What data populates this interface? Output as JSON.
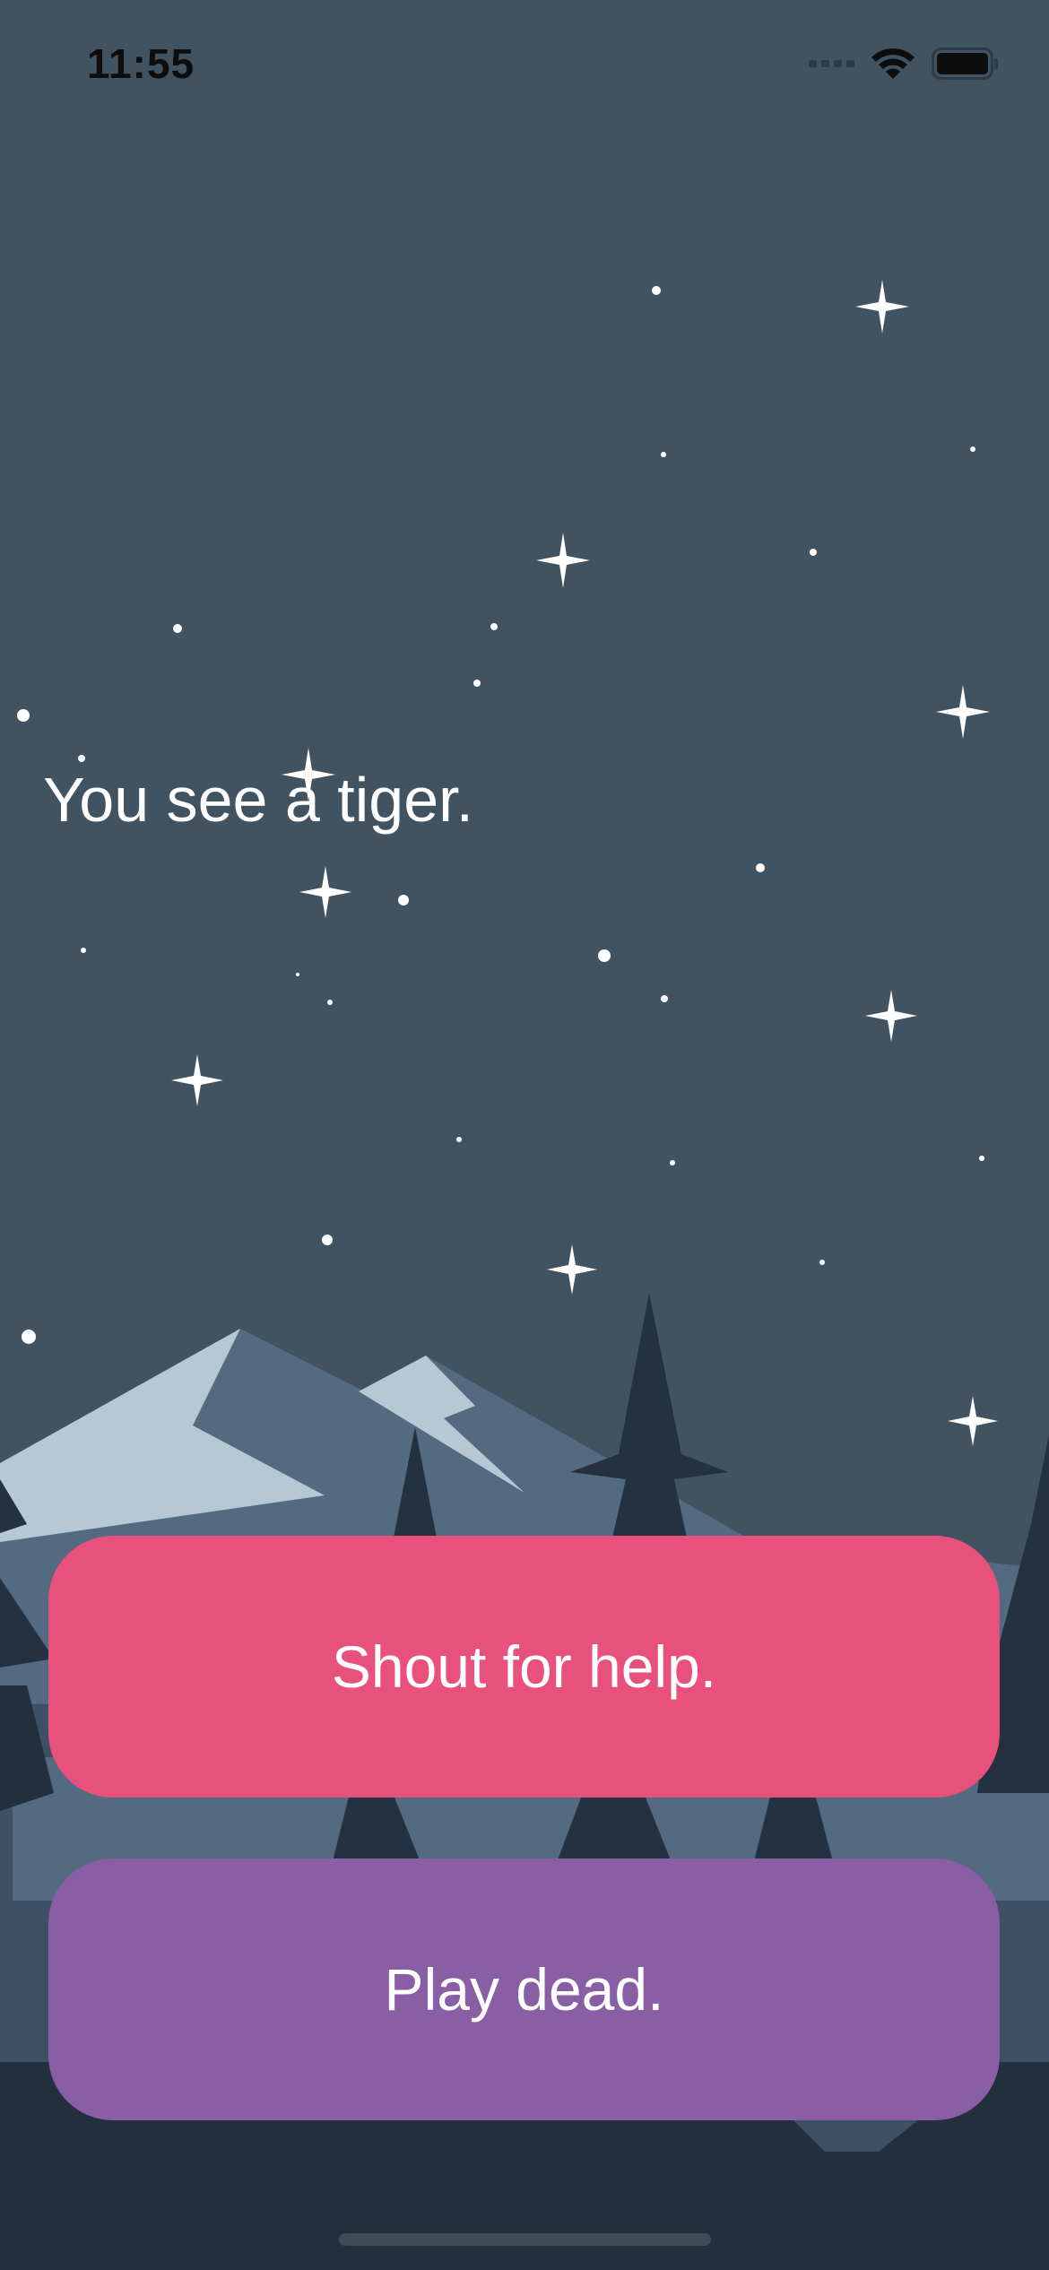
{
  "status_bar": {
    "time": "11:55",
    "icons": [
      "signal-icon",
      "wifi-icon",
      "battery-icon"
    ]
  },
  "story": {
    "text": "You see a tiger."
  },
  "choices": [
    {
      "label": "Shout for help.",
      "color": "#e8517b"
    },
    {
      "label": "Play dead.",
      "color": "#895ea5"
    }
  ],
  "colors": {
    "sky": "#415261",
    "ground": "#222f3c",
    "mountain_snow": "#b5c8d4",
    "mountain_shadow": "#546a80",
    "trees": "#243140"
  }
}
